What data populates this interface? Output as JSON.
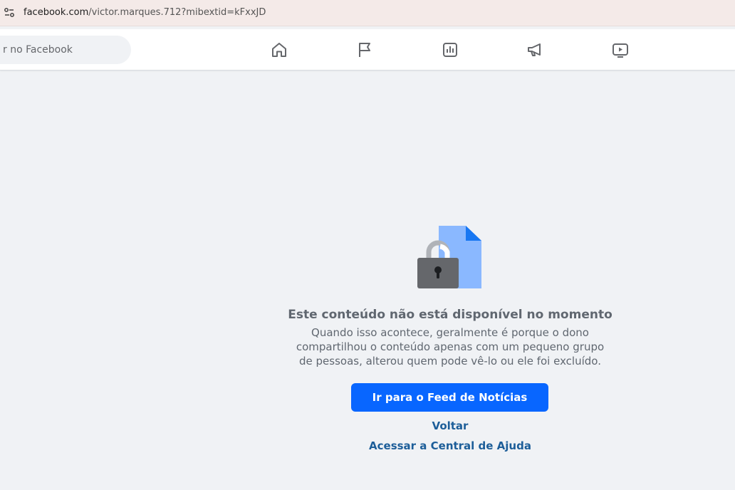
{
  "browser": {
    "url_domain": "facebook.com",
    "url_path": "/victor.marques.712?mibextid=kFxxJD",
    "site_info_icon": "site-settings-icon"
  },
  "topnav": {
    "search_placeholder": "r no Facebook",
    "nav_items": [
      {
        "name": "home-icon"
      },
      {
        "name": "flag-icon"
      },
      {
        "name": "chart-icon"
      },
      {
        "name": "megaphone-icon"
      },
      {
        "name": "video-icon"
      }
    ]
  },
  "main": {
    "illustration": "locked-content-icon",
    "title": "Este conteúdo não está disponível no momento",
    "description_lines": [
      "Quando isso acontece, geralmente é porque o dono",
      "compartilhou o conteúdo apenas com um pequeno grupo",
      "de pessoas, alterou quem pode vê-lo ou ele foi excluído."
    ],
    "primary_button": "Ir para o Feed de Notícias",
    "back_link": "Voltar",
    "help_link": "Acessar a Central de Ajuda"
  },
  "colors": {
    "accent": "#0866ff",
    "link": "#1d5e99",
    "background": "#f0f2f5",
    "text_muted": "#606770"
  }
}
